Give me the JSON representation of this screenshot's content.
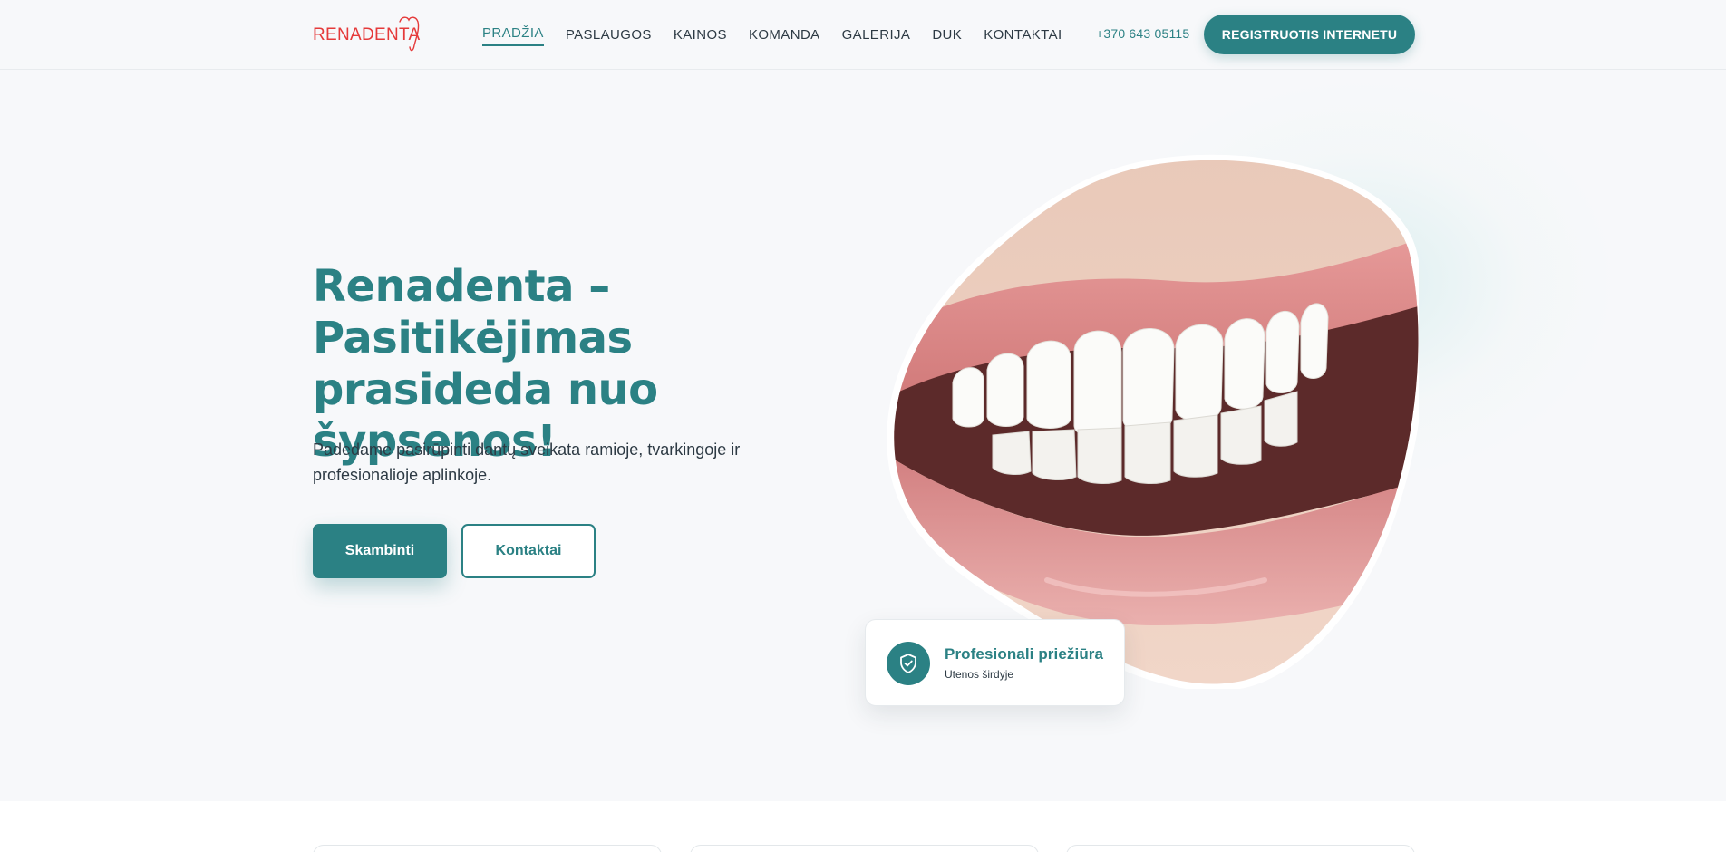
{
  "header": {
    "logo_text": "RENADENTA",
    "nav": [
      {
        "label": "PRADŽIA",
        "active": true
      },
      {
        "label": "PASLAUGOS",
        "active": false
      },
      {
        "label": "KAINOS",
        "active": false
      },
      {
        "label": "KOMANDA",
        "active": false
      },
      {
        "label": "GALERIJA",
        "active": false
      },
      {
        "label": "DUK",
        "active": false
      },
      {
        "label": "KONTAKTAI",
        "active": false
      }
    ],
    "phone": "+370 643 05115",
    "register_label": "REGISTRUOTIS INTERNETU"
  },
  "hero": {
    "title": "Renadenta – Pasitikėjimas prasideda nuo šypsenos!",
    "subtitle": "Padedame pasirūpinti dantų sveikata ramioje, tvarkingoje ir profesionalioje aplinkoje.",
    "call_label": "Skambinti",
    "contacts_label": "Kontaktai",
    "image_icon": "smile-photo"
  },
  "badge": {
    "title": "Profesionali priežiūra",
    "subtitle": "Utenos širdyje",
    "icon": "shield-check-icon"
  },
  "colors": {
    "primary": "#2b8184",
    "logo_red": "#e53a3a",
    "page_bg": "#f7f8fa",
    "text": "#2d3a44"
  }
}
